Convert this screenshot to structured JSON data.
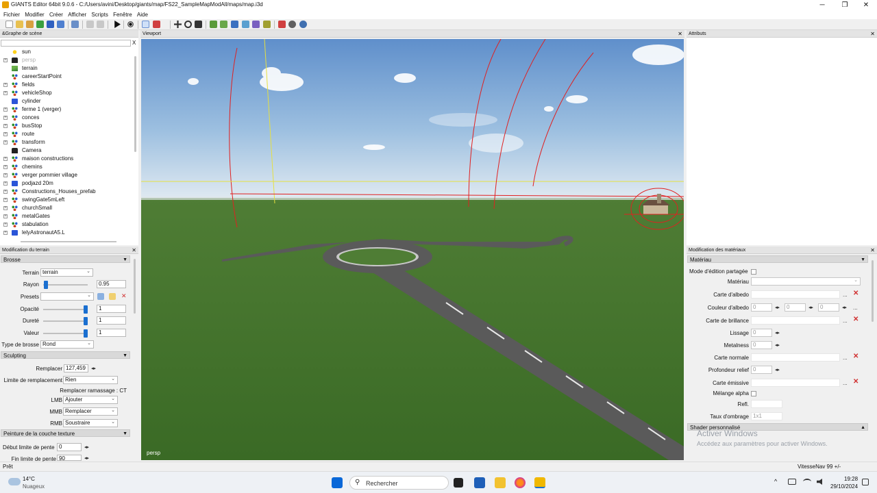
{
  "window": {
    "title": "GIANTS Editor 64bit 9.0.6 - C:/Users/avini/Desktop/giants/map/FS22_SampleMapModAll/maps/map.i3d",
    "minimize": "─",
    "maximize": "❐",
    "close": "✕"
  },
  "menu": [
    "Fichier",
    "Modifier",
    "Créer",
    "Afficher",
    "Scripts",
    "Fenêtre",
    "Aide"
  ],
  "scene_graph": {
    "title": "&Graphe de scène",
    "close": "✕",
    "filter_clear": "X",
    "items": [
      {
        "label": "sun",
        "icon": "light-icon",
        "expand": ""
      },
      {
        "label": "persp",
        "icon": "camera-icon",
        "expand": "+",
        "muted": true
      },
      {
        "label": "terrain",
        "icon": "terrain-icon",
        "expand": ""
      },
      {
        "label": "careerStartPoint",
        "icon": "transform-group-icon",
        "expand": ""
      },
      {
        "label": "fields",
        "icon": "transform-group-icon",
        "expand": "+"
      },
      {
        "label": "vehicleShop",
        "icon": "transform-group-icon",
        "expand": "+"
      },
      {
        "label": "cylinder",
        "icon": "shape-icon",
        "expand": ""
      },
      {
        "label": "ferme 1 (verger)",
        "icon": "transform-group-icon",
        "expand": "+"
      },
      {
        "label": "conces",
        "icon": "transform-group-icon",
        "expand": "+"
      },
      {
        "label": "busStop",
        "icon": "transform-group-icon",
        "expand": "+"
      },
      {
        "label": "route",
        "icon": "transform-group-icon",
        "expand": "+"
      },
      {
        "label": "transform",
        "icon": "transform-group-icon",
        "expand": "+"
      },
      {
        "label": "Camera",
        "icon": "camera-icon",
        "expand": ""
      },
      {
        "label": "maison constructions",
        "icon": "transform-group-icon",
        "expand": "+"
      },
      {
        "label": "chemins",
        "icon": "transform-group-icon",
        "expand": "+"
      },
      {
        "label": "verger pommier village",
        "icon": "transform-group-icon",
        "expand": "+"
      },
      {
        "label": "podjazd 20m",
        "icon": "shape-icon",
        "expand": "+"
      },
      {
        "label": "Constructions_Houses_prefab",
        "icon": "transform-group-icon",
        "expand": "+"
      },
      {
        "label": "swingGate5mLeft",
        "icon": "transform-group-icon",
        "expand": "+"
      },
      {
        "label": "churchSmall",
        "icon": "transform-group-icon",
        "expand": "+"
      },
      {
        "label": "metalGates",
        "icon": "transform-group-icon",
        "expand": "+"
      },
      {
        "label": "stabulation",
        "icon": "transform-group-icon",
        "expand": "+"
      },
      {
        "label": "lelyAstronautA5.L",
        "icon": "shape-icon",
        "expand": "+"
      }
    ]
  },
  "terrain_mod": {
    "title": "Modification du terrain",
    "close": "✕",
    "brush_section": "Brosse",
    "terrain_label": "Terrain",
    "terrain_value": "terrain",
    "radius_label": "Rayon",
    "radius_value": "0.95",
    "presets_label": "Presets",
    "presets_value": "",
    "opacity_label": "Opacité",
    "opacity_value": "1",
    "hardness_label": "Dureté",
    "hardness_value": "1",
    "value_label": "Valeur",
    "value_value": "1",
    "brush_type_label": "Type de brosse",
    "brush_type_value": "Rond",
    "sculpt_section": "Sculpting",
    "replace_label": "Remplacer",
    "replace_value": "127,459",
    "replace_limit_label": "Limite de remplacement",
    "replace_limit_value": "Rien",
    "pick_label": "Remplacer ramassage : CT",
    "lmb_label": "LMB",
    "lmb_value": "Ajouter",
    "mmb_label": "MMB",
    "mmb_value": "Remplacer",
    "rmb_label": "RMB",
    "rmb_value": "Soustraire",
    "paint_section": "Peinture de la couche texture",
    "slope_start_label": "Début limite de pente",
    "slope_start_value": "0",
    "slope_end_label": "Fin limite de pente",
    "slope_end_value": "90",
    "slider_levels": {
      "radius": 0.02,
      "opacity": 1,
      "hardness": 1,
      "value": 1
    }
  },
  "viewport": {
    "title": "Viewport",
    "close": "✕",
    "camera_label": "persp"
  },
  "attributes": {
    "title": "Attributs",
    "close": "✕"
  },
  "materials": {
    "title": "Modification des matériaux",
    "close": "✕",
    "section": "Matériau",
    "shared_edit_label": "Mode d'édition partagée",
    "material_label": "Matériau",
    "albedo_map_label": "Carte d'albedo",
    "albedo_color_label": "Couleur d'albedo",
    "albedo_r": "0",
    "albedo_g": "0",
    "albedo_b": "0",
    "gloss_map_label": "Carte de brillance",
    "smoothness_label": "Lissage",
    "smoothness_value": "0",
    "metalness_label": "Metalness",
    "metalness_value": "0",
    "normal_map_label": "Carte normale",
    "relief_label": "Profondeur relief",
    "relief_value": "0",
    "emissive_label": "Carte émissive",
    "alpha_label": "Mélange alpha",
    "refl_label": "Refl.",
    "shading_label": "Taux d'ombrage",
    "shading_value": "1x1",
    "shader_section": "Shader personnalisé",
    "browse": "...",
    "clear": "✕"
  },
  "watermark": {
    "line1": "Activer Windows",
    "line2": "Accédez aux paramètres pour activer Windows."
  },
  "status": {
    "left": "Prêt",
    "right": "VitesseNav 99 +/-"
  },
  "taskbar": {
    "weather_temp": "14°C",
    "weather_desc": "Nuageux",
    "search_placeholder": "Rechercher",
    "time": "19:28",
    "date": "29/10/2024",
    "tray_chevron": "^"
  },
  "colors": {
    "selection_blue": "#1a6fd0",
    "grass": "#3e6e2a",
    "sky": "#7aa6d8",
    "road": "#5a5a5a",
    "gizmo_red": "#e02020",
    "gizmo_yellow": "#e6e040"
  }
}
